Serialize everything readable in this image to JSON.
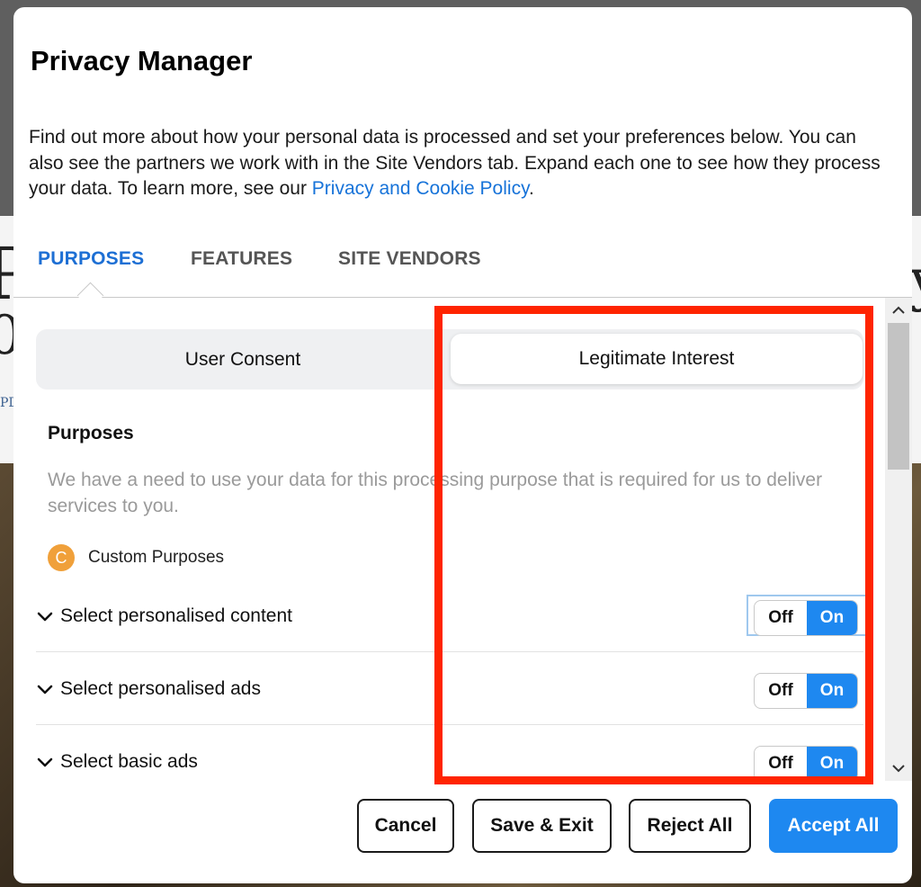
{
  "background": {
    "glyph_top": "P",
    "glyph_mid": "0",
    "glyph_small": "PD",
    "glyph_right": "y."
  },
  "modal": {
    "title": "Privacy Manager",
    "intro_text": "Find out more about how your personal data is processed and set your preferences below. You can also see the partners we work with in the Site Vendors tab. Expand each one to see how they process your data. To learn more, see our ",
    "intro_link": "Privacy and Cookie Policy",
    "intro_end": ".",
    "tabs": [
      {
        "label": "PURPOSES",
        "active": true
      },
      {
        "label": "FEATURES",
        "active": false
      },
      {
        "label": "SITE VENDORS",
        "active": false
      }
    ],
    "segmented": {
      "left": "User Consent",
      "right": "Legitimate Interest",
      "selected": "Legitimate Interest"
    },
    "section": {
      "title": "Purposes",
      "description": "We have a need to use your data for this processing purpose that is required for us to deliver services to you."
    },
    "custom": {
      "badge": "C",
      "label": "Custom Purposes"
    },
    "purposes": [
      {
        "label": "Select personalised content",
        "off": "Off",
        "on": "On",
        "value": "On"
      },
      {
        "label": "Select personalised ads",
        "off": "Off",
        "on": "On",
        "value": "On"
      },
      {
        "label": "Select basic ads",
        "off": "Off",
        "on": "On",
        "value": "On"
      }
    ],
    "buttons": {
      "cancel": "Cancel",
      "save_exit": "Save & Exit",
      "reject_all": "Reject All",
      "accept_all": "Accept All"
    }
  },
  "colors": {
    "accent": "#1e88f0",
    "tab_active": "#1d6fd4",
    "link": "#1773d9",
    "badge": "#f0a03a",
    "highlight": "#ff2400"
  },
  "icons": {
    "chevron": "chevron-down-icon",
    "scroll_up": "arrow-up-icon",
    "scroll_down": "arrow-down-icon"
  }
}
